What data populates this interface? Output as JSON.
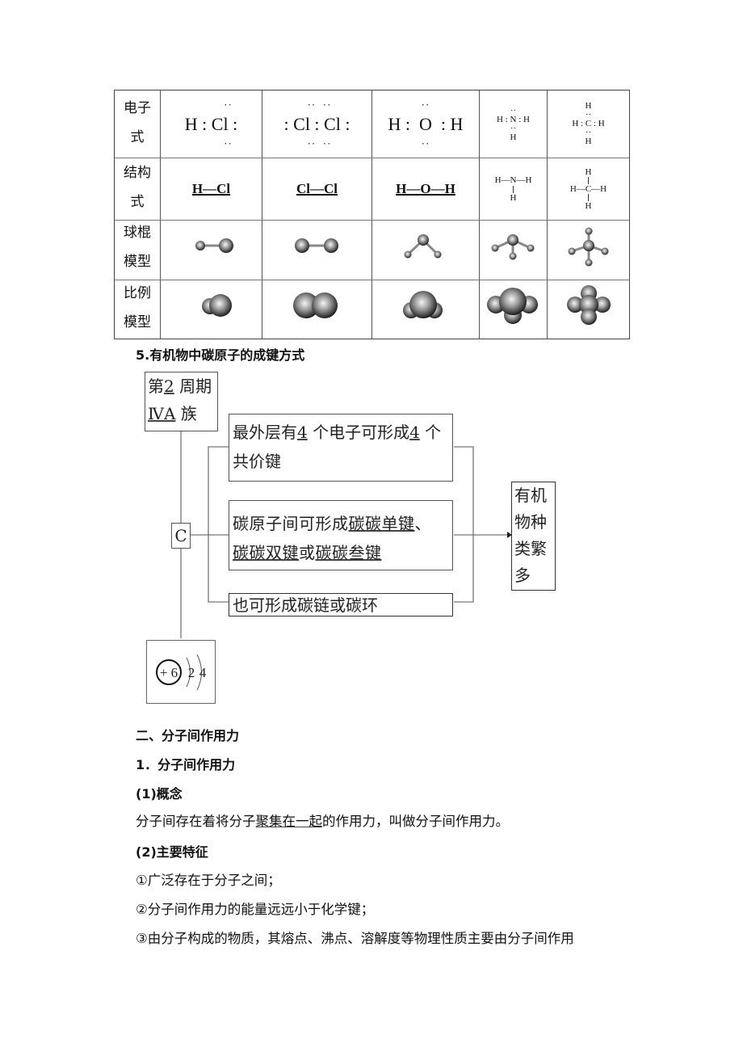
{
  "table": {
    "row_labels": [
      "电子式",
      "结构式",
      "球棍模型",
      "比例模型"
    ],
    "row_label_lines": [
      [
        "电子",
        "式"
      ],
      [
        "结构",
        "式"
      ],
      [
        "球棍",
        "模型"
      ],
      [
        "比例",
        "模型"
      ]
    ],
    "molecules": [
      "HCl",
      "Cl2",
      "H2O",
      "NH3",
      "CH4"
    ],
    "electron_formulas": {
      "hcl": {
        "line": "H : Cl :",
        "top_dots": "··",
        "bottom_dots": "··"
      },
      "cl2": {
        "line": ": Cl : Cl :",
        "top_dots": "··  ··",
        "bottom_dots": "··  ··"
      },
      "h2o": {
        "line": "H :  O  : H",
        "top_dots": "··",
        "bottom_dots": "··"
      },
      "nh3": {
        "top": "··",
        "middle": "H : N : H",
        "dots_below": "··",
        "bottom": "H"
      },
      "ch4": {
        "top": "H",
        "dots_above": "··",
        "middle": "H : C : H",
        "dots_below": "··",
        "bottom": "H"
      }
    },
    "structural_formulas": {
      "hcl": "H—Cl",
      "cl2": "Cl—Cl",
      "h2o": "H—O—H",
      "nh3": {
        "middle": "H—N—H",
        "bottom": "H"
      },
      "ch4": {
        "top": "H",
        "middle": "H—C—H",
        "bottom": "H"
      }
    },
    "ball_stick_models": [
      "HCl ball-and-stick",
      "Cl2 ball-and-stick",
      "H2O ball-and-stick",
      "NH3 ball-and-stick",
      "CH4 ball-and-stick"
    ],
    "space_fill_models": [
      "HCl space-filling",
      "Cl2 space-filling",
      "H2O space-filling",
      "NH3 space-filling",
      "CH4 space-filling"
    ]
  },
  "section5": {
    "title": "5.有机物中碳原子的成键方式",
    "period_box": {
      "line1_pre": "第",
      "line1_u": "2",
      "line1_post": " 周期",
      "line2_u": "ⅣA",
      "line2_post": " 族"
    },
    "carbon_label": "C",
    "atom_structure": {
      "nucleus": "+ 6",
      "shell1": "2",
      "shell2": "4"
    },
    "bond_box1": {
      "pre": "最外层有",
      "u1": "4",
      "mid": " 个电子可形成",
      "u2": "4",
      "post": " 个",
      "line2": "共价键"
    },
    "bond_box2": {
      "pre": "碳原子间可形成",
      "u1": "碳碳单键",
      "sep": "、",
      "u2": "碳碳双键",
      "or": "或",
      "u3": "碳碳叁键"
    },
    "bond_box3": "也可形成碳链或碳环",
    "result_box": [
      "有机",
      "物种",
      "类繁",
      "多"
    ]
  },
  "section2": {
    "title": "二、分子间作用力",
    "sub1": "1．分子间作用力",
    "concept_label": "(1)概念",
    "concept_pre": "分子间存在着将分子",
    "concept_u": "聚集在一起",
    "concept_post": "的作用力，叫做分子间作用力。",
    "features_label": "(2)主要特征",
    "features": [
      "①广泛存在于分子之间；",
      "②分子间作用力的能量远远小于化学键；",
      "③由分子构成的物质，其熔点、沸点、溶解度等物理性质主要由分子间作用"
    ]
  }
}
